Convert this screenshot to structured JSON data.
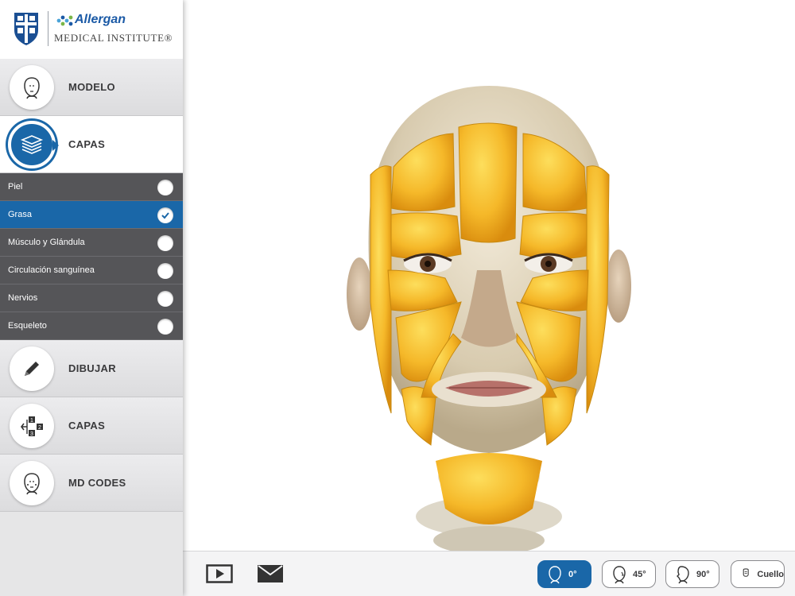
{
  "brand": {
    "name": "Allergan",
    "subtitle": "MEDICAL INSTITUTE®"
  },
  "menu": {
    "modelo": "MODELO",
    "capas": "CAPAS",
    "dibujar": "DIBUJAR",
    "capas2": "CAPAS",
    "mdcodes": "MD CODES"
  },
  "layers": [
    {
      "label": "Piel",
      "checked": false
    },
    {
      "label": "Grasa",
      "checked": true
    },
    {
      "label": "Músculo y Glándula",
      "checked": false
    },
    {
      "label": "Circulación sanguínea",
      "checked": false
    },
    {
      "label": "Nervios",
      "checked": false
    },
    {
      "label": "Esqueleto",
      "checked": false
    }
  ],
  "views": {
    "v0": "0°",
    "v45": "45°",
    "v90": "90°",
    "cuello": "Cuello"
  },
  "colors": {
    "accent": "#1a67a8",
    "fat": "#f5b829",
    "skin": "#d9c3a6"
  },
  "icons": {
    "play": "play-icon",
    "mail": "mail-icon"
  }
}
